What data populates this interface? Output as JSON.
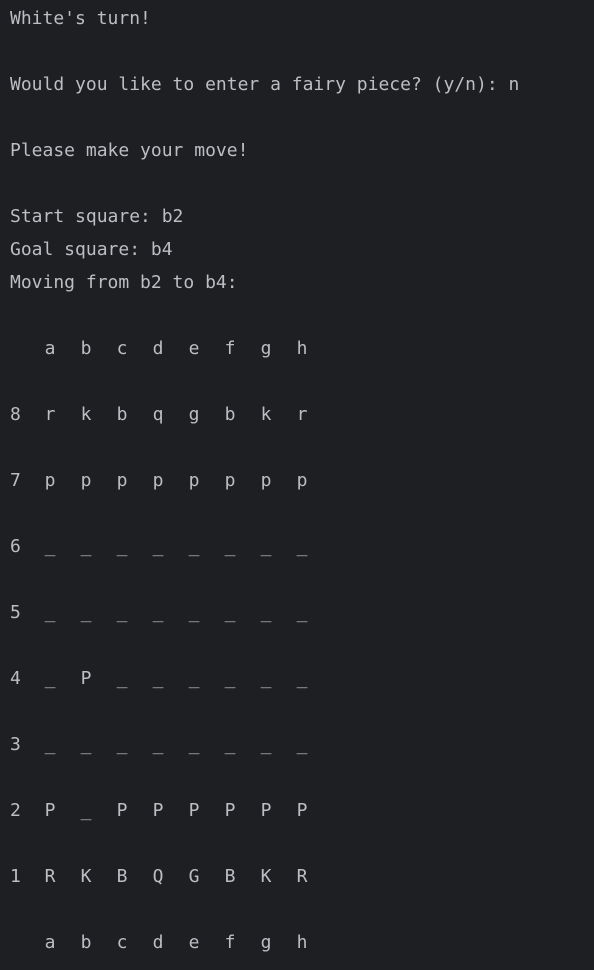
{
  "console": {
    "turn_text": "White's turn!",
    "fairy_prompt": "Would you like to enter a fairy piece? (y/n): ",
    "fairy_answer": "n",
    "move_prompt": "Please make your move!",
    "start_prompt": "Start square: ",
    "start_value": "b2",
    "goal_prompt": "Goal square: ",
    "goal_value": "b4",
    "moving_text": "Moving from b2 to b4:"
  },
  "board": {
    "files": [
      "a",
      "b",
      "c",
      "d",
      "e",
      "f",
      "g",
      "h"
    ],
    "rows": [
      {
        "rank": "8",
        "cells": [
          "r",
          "k",
          "b",
          "q",
          "g",
          "b",
          "k",
          "r"
        ]
      },
      {
        "rank": "7",
        "cells": [
          "p",
          "p",
          "p",
          "p",
          "p",
          "p",
          "p",
          "p"
        ]
      },
      {
        "rank": "6",
        "cells": [
          "_",
          "_",
          "_",
          "_",
          "_",
          "_",
          "_",
          "_"
        ]
      },
      {
        "rank": "5",
        "cells": [
          "_",
          "_",
          "_",
          "_",
          "_",
          "_",
          "_",
          "_"
        ]
      },
      {
        "rank": "4",
        "cells": [
          "_",
          "P",
          "_",
          "_",
          "_",
          "_",
          "_",
          "_"
        ]
      },
      {
        "rank": "3",
        "cells": [
          "_",
          "_",
          "_",
          "_",
          "_",
          "_",
          "_",
          "_"
        ]
      },
      {
        "rank": "2",
        "cells": [
          "P",
          "_",
          "P",
          "P",
          "P",
          "P",
          "P",
          "P"
        ]
      },
      {
        "rank": "1",
        "cells": [
          "R",
          "K",
          "B",
          "Q",
          "G",
          "B",
          "K",
          "R"
        ]
      }
    ]
  },
  "colors": {
    "background": "#1e1f22",
    "text": "#bcbec4"
  }
}
